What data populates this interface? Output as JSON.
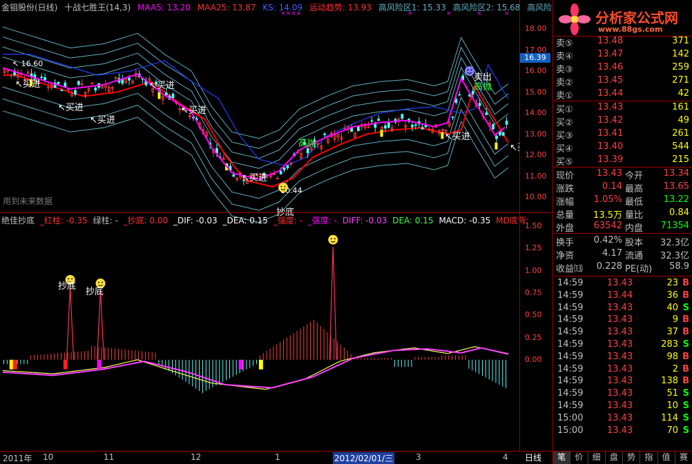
{
  "header": {
    "stock": "金钼股份(日线)",
    "indicator": "十战七胜王(14,3)",
    "maa5": "MAA5: 13.20",
    "maa25": "MAA25: 13.87",
    "ks": "KS: 14.09",
    "trend": "运动趋势: 13.93",
    "risk1": "高风险区1: 15.33",
    "risk2": "高风险区2: 15.68",
    "risk3": "高风险 ◇"
  },
  "watermark": "用到未来数据",
  "subheader": {
    "title": "绝佳抄底",
    "red": "_红柱: -0.35",
    "green": "绿柱: -",
    "chaodi": "_抄底: 0.00",
    "dif": "_DIF: -0.03",
    "dea": "_DEA: 0.15",
    "qiangdu1": "_强度: -",
    "qiangdu2": "_强度: -",
    "diff": "DIFF: -0.03",
    "dea2": "DEA: 0.15",
    "macd": "MACD: -0.35",
    "md": "MD底背:"
  },
  "annotations": {
    "high": "16.60",
    "low": "10.44",
    "buy": "买进",
    "sell": "卖出",
    "high_throw": "高抛",
    "bottom": "抄底"
  },
  "price_axis": [
    "18.00",
    "17.00",
    "16.00",
    "15.00",
    "14.00",
    "13.00",
    "12.00",
    "11.00",
    "10.00"
  ],
  "current_price": "16.39",
  "macd_axis": [
    "1.50",
    "1.25",
    "1.00",
    "0.75",
    "0.50",
    "0.25",
    "0.00"
  ],
  "time_axis": [
    "2011年",
    "10",
    "11",
    "12",
    "1",
    "2012/02/01/三",
    "3",
    "4"
  ],
  "period": "日线",
  "logo": {
    "name": "分析家公式网",
    "url": "www.88gs.com"
  },
  "orderbook": {
    "asks": [
      {
        "label": "卖⑤",
        "price": "13.48",
        "vol": "371"
      },
      {
        "label": "卖④",
        "price": "13.47",
        "vol": "142"
      },
      {
        "label": "卖③",
        "price": "13.46",
        "vol": "259"
      },
      {
        "label": "卖②",
        "price": "13.45",
        "vol": "271"
      },
      {
        "label": "卖①",
        "price": "13.44",
        "vol": "42"
      }
    ],
    "bids": [
      {
        "label": "买①",
        "price": "13.43",
        "vol": "161"
      },
      {
        "label": "买②",
        "price": "13.42",
        "vol": "49"
      },
      {
        "label": "买③",
        "price": "13.41",
        "vol": "261"
      },
      {
        "label": "买④",
        "price": "13.40",
        "vol": "544"
      },
      {
        "label": "买⑤",
        "price": "13.39",
        "vol": "215"
      }
    ]
  },
  "quote": [
    {
      "l1": "现价",
      "v1": "13.43",
      "c1": "#ff4040",
      "l2": "今开",
      "v2": "13.34",
      "c2": "#ff4040"
    },
    {
      "l1": "涨跌",
      "v1": "0.14",
      "c1": "#ff4040",
      "l2": "最高",
      "v2": "13.65",
      "c2": "#ff4040"
    },
    {
      "l1": "涨幅",
      "v1": "1.05%",
      "c1": "#ff4040",
      "l2": "最低",
      "v2": "13.22",
      "c2": "#00ff00"
    },
    {
      "l1": "总量",
      "v1": "13.5万",
      "c1": "#ffff00",
      "l2": "量比",
      "v2": "0.84",
      "c2": "#ffff00"
    },
    {
      "l1": "外盘",
      "v1": "63542",
      "c1": "#ff4040",
      "l2": "内盘",
      "v2": "71354",
      "c2": "#00ff00"
    }
  ],
  "quote2": [
    {
      "l1": "换手",
      "v1": "0.42%",
      "c1": "#c0c0c0",
      "l2": "股本",
      "v2": "32.3亿",
      "c2": "#c0c0c0"
    },
    {
      "l1": "净资",
      "v1": "4.17",
      "c1": "#c0c0c0",
      "l2": "流通",
      "v2": "32.3亿",
      "c2": "#c0c0c0"
    },
    {
      "l1": "收益⒀",
      "v1": "0.228",
      "c1": "#c0c0c0",
      "l2": "PE(动)",
      "v2": "58.9",
      "c2": "#c0c0c0"
    }
  ],
  "ticks": [
    {
      "t": "14:59",
      "p": "13.43",
      "v": "23",
      "s": "B"
    },
    {
      "t": "14:59",
      "p": "13.44",
      "v": "36",
      "s": "B"
    },
    {
      "t": "14:59",
      "p": "13.43",
      "v": "40",
      "s": "S"
    },
    {
      "t": "14:59",
      "p": "13.43",
      "v": "9",
      "s": "B"
    },
    {
      "t": "14:59",
      "p": "13.43",
      "v": "37",
      "s": "B"
    },
    {
      "t": "14:59",
      "p": "13.43",
      "v": "283",
      "s": "S"
    },
    {
      "t": "14:59",
      "p": "13.43",
      "v": "98",
      "s": "B"
    },
    {
      "t": "14:59",
      "p": "13.43",
      "v": "2",
      "s": "B"
    },
    {
      "t": "14:59",
      "p": "13.43",
      "v": "138",
      "s": "B"
    },
    {
      "t": "14:59",
      "p": "13.43",
      "v": "51",
      "s": "S"
    },
    {
      "t": "14:59",
      "p": "13.43",
      "v": "10",
      "s": "S"
    },
    {
      "t": "15:00",
      "p": "13.43",
      "v": "114",
      "s": "S"
    },
    {
      "t": "15:00",
      "p": "13.43",
      "v": "70",
      "s": "S"
    }
  ],
  "tabs": [
    "笔",
    "价",
    "细",
    "盘",
    "势",
    "指",
    "值",
    "赛"
  ],
  "colors": {
    "up": "#ff4040",
    "down": "#00ff00",
    "ma5": "#ff00ff",
    "ma25": "#ff0000",
    "ks": "#2040ff",
    "band": "#5fb0c0",
    "yellow": "#ffff00"
  }
}
